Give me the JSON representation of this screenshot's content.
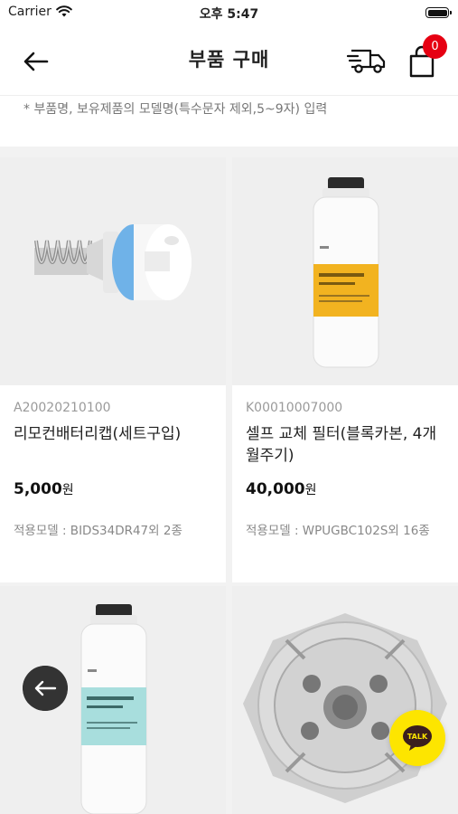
{
  "status_bar": {
    "carrier": "Carrier",
    "time": "오후 5:47"
  },
  "header": {
    "title": "부품 구매",
    "cart_count": "0"
  },
  "search_hint": "* 부품명, 보유제품의 모델명(특수문자 제외,5~9자) 입력",
  "products": [
    {
      "code": "A20020210100",
      "name": "리모컨배터리캡(세트구입)",
      "price": "5,000",
      "price_unit": "원",
      "model": "적용모델 : BIDS34DR47외 2종"
    },
    {
      "code": "K00010007000",
      "name": "셀프 교체 필터(블록카본, 4개월주기)",
      "price": "40,000",
      "price_unit": "원",
      "model": "적용모델 : WPUGBC102S외 16종"
    }
  ],
  "talk_button": {
    "label": "TALK"
  },
  "colors": {
    "badge": "#e60012",
    "talk": "#fde500",
    "accent_blue": "#6fb2e8",
    "label_yellow": "#f2b320",
    "label_teal": "#a8dedd"
  }
}
